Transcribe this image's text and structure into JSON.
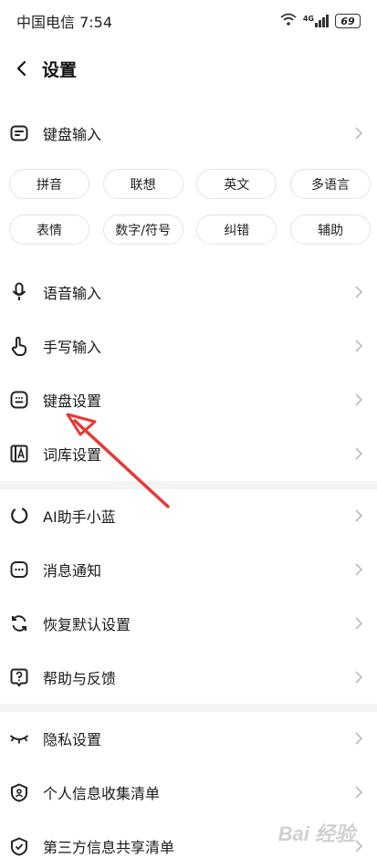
{
  "status_bar": {
    "carrier": "中国电信",
    "time": "7:54",
    "network": "4G",
    "battery": "69"
  },
  "header": {
    "title": "设置"
  },
  "keyboard_input": {
    "label": "键盘输入"
  },
  "chips_row1": [
    "拼音",
    "联想",
    "英文",
    "多语言"
  ],
  "chips_row2": [
    "表情",
    "数字/符号",
    "纠错",
    "辅助"
  ],
  "section1": [
    {
      "label": "语音输入",
      "icon": "microphone-icon"
    },
    {
      "label": "手写输入",
      "icon": "hand-pointer-icon"
    },
    {
      "label": "键盘设置",
      "icon": "keyboard-icon"
    },
    {
      "label": "词库设置",
      "icon": "dictionary-icon"
    }
  ],
  "section2": [
    {
      "label": "AI助手小蓝",
      "icon": "ai-assistant-icon"
    },
    {
      "label": "消息通知",
      "icon": "message-icon"
    },
    {
      "label": "恢复默认设置",
      "icon": "restore-icon"
    },
    {
      "label": "帮助与反馈",
      "icon": "help-icon"
    }
  ],
  "section3": [
    {
      "label": "隐私设置",
      "icon": "eye-closed-icon"
    },
    {
      "label": "个人信息收集清单",
      "icon": "personal-info-icon"
    },
    {
      "label": "第三方信息共享清单",
      "icon": "shield-check-icon"
    }
  ],
  "watermark": "Bai 经验",
  "annotation_color": "#e53935"
}
